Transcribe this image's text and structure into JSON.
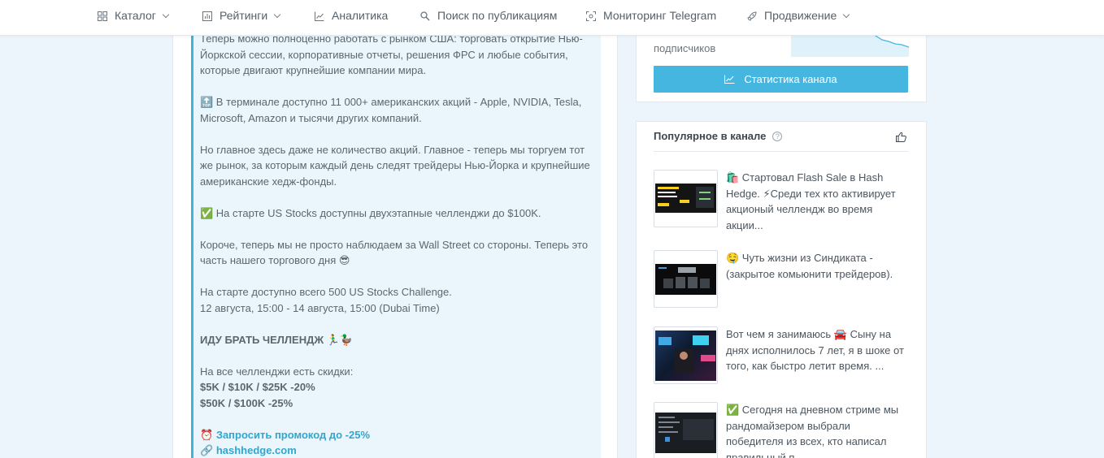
{
  "nav": {
    "catalog": "Каталог",
    "ratings": "Рейтинги",
    "analytics": "Аналитика",
    "search": "Поиск по публикациям",
    "monitoring": "Мониторинг Telegram",
    "promotion": "Продвижение"
  },
  "post": {
    "p1": "Теперь можно полноценно работать с рынком США: торговать открытие Нью-Йоркской сессии, корпоративные отчеты, решения ФРС и любые события, которые двигают крупнейшие компании мира.",
    "p2": "🔝 В терминале доступно 11 000+ американских акций - Apple, NVIDIA, Tesla, Microsoft, Amazon и тысячи других компаний.",
    "p3": "Но главное здесь даже не количество акций. Главное - теперь мы торгуем тот же рынок, за которым каждый день следят трейдеры Нью-Йорка и крупнейшие американские хедж-фонды.",
    "p4": "✅ На старте US Stocks доступны двухэтапные челленджи до $100K.",
    "p5": "Короче, теперь мы не просто наблюдаем за Wall Street со стороны. Теперь это часть нашего торгового дня 😎",
    "p6a": "На старте доступно всего 500 US Stocks Challenge.",
    "p6b": "12 августа, 15:00 - 14 августа, 15:00 (Dubai Time)",
    "p7": "ИДУ БРАТЬ ЧЕЛЛЕНДЖ 🏃‍♂️🦆",
    "p8a": "На все челленджи есть скидки:",
    "p8b": "$5K / $10K / $25K -20%",
    "p8c": "$50K / $100K -25%",
    "promo_icon": "⏰",
    "promo_link": "Запросить промокод до -25%",
    "site_icon": "🔗",
    "site_link": "hashhedge.com"
  },
  "stats": {
    "subs_label": "подписчиков",
    "button_label": "Статистика канала"
  },
  "popular": {
    "title": "Популярное в канале",
    "help": "?",
    "items": [
      {
        "text": "🛍️ Стартовал Flash Sale в Hash Hedge. ⚡Среди тех кто активирует акционый челлендж во время акции..."
      },
      {
        "text": "🤤 Чуть жизни из Синдиката - (закрытое комьюнити трейдеров)."
      },
      {
        "text": "Вот чем я занимаюсь 🚘 Сыну на днях исполнилось 7 лет, я в шоке от того, как быстро летит время. ..."
      },
      {
        "text": "✅ Сегодня на дневном стриме мы рандомайзером выбрали победителя из всех, кто написал правильный п..."
      }
    ]
  },
  "colors": {
    "accent": "#45b6e0",
    "quote_border": "#3cb4dc",
    "quote_bg": "#eaf6fc",
    "page_bg": "#edf5fc"
  }
}
